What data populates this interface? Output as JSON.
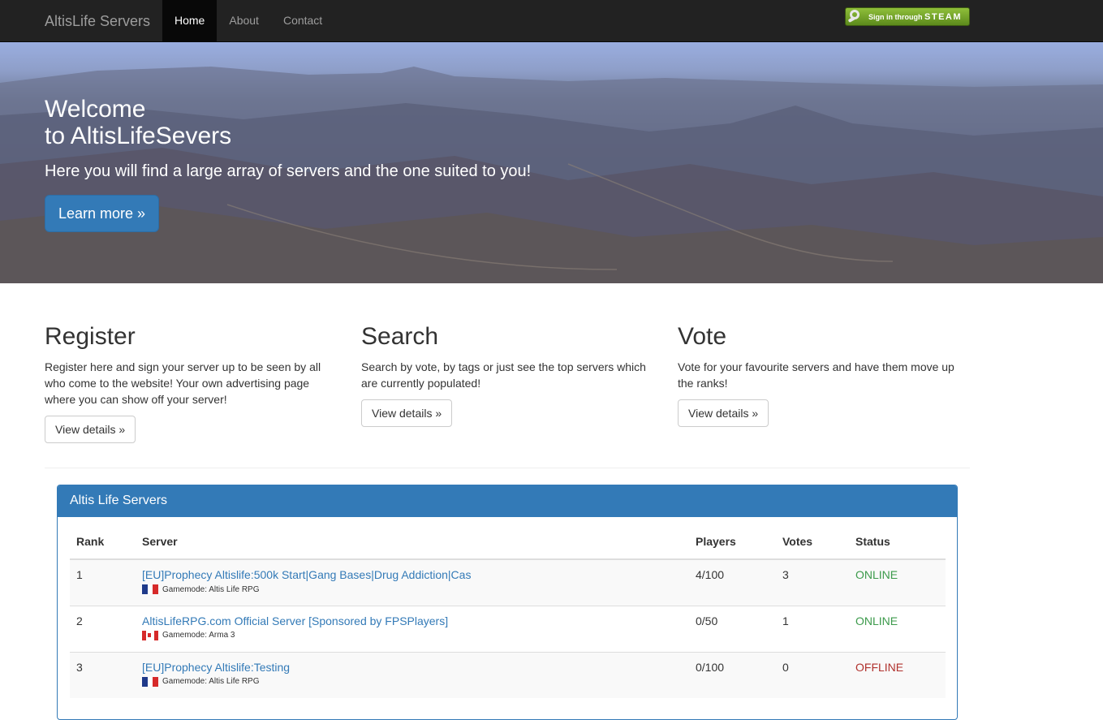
{
  "navbar": {
    "brand": "AltisLife Servers",
    "links": [
      {
        "label": "Home",
        "active": true
      },
      {
        "label": "About",
        "active": false
      },
      {
        "label": "Contact",
        "active": false
      }
    ],
    "steam_button": {
      "prefix": "Sign in through",
      "brand": "STEAM",
      "icon": "steam-logo-icon"
    }
  },
  "hero": {
    "title_line1": "Welcome",
    "title_line2": "to AltisLifeSevers",
    "subtitle": "Here you will find a large array of servers and the one suited to you!",
    "button_label": "Learn more »"
  },
  "features": [
    {
      "title": "Register",
      "text": "Register here and sign your server up to be seen by all who come to the website! Your own advertising page where you can show off your server!",
      "button": "View details »"
    },
    {
      "title": "Search",
      "text": "Search by vote, by tags or just see the top servers which are currently populated!",
      "button": "View details »"
    },
    {
      "title": "Vote",
      "text": "Vote for your favourite servers and have them move up the ranks!",
      "button": "View details »"
    }
  ],
  "servers_panel": {
    "title": "Altis Life Servers",
    "columns": [
      "Rank",
      "Server",
      "Players",
      "Votes",
      "Status"
    ],
    "rows": [
      {
        "rank": "1",
        "name": "[EU]Prophecy Altislife:500k Start|Gang Bases|Drug Addiction|Cas",
        "gamemode": "Gamemode: Altis Life RPG",
        "flag": "france",
        "players": "4/100",
        "votes": "3",
        "status": "ONLINE"
      },
      {
        "rank": "2",
        "name": "AltisLifeRPG.com Official Server [Sponsored by FPSPlayers]",
        "gamemode": "Gamemode: Arma 3",
        "flag": "canada",
        "players": "0/50",
        "votes": "1",
        "status": "ONLINE"
      },
      {
        "rank": "3",
        "name": "[EU]Prophecy Altislife:Testing",
        "gamemode": "Gamemode: Altis Life RPG",
        "flag": "france",
        "players": "0/100",
        "votes": "0",
        "status": "OFFLINE"
      }
    ]
  },
  "colors": {
    "primary": "#337ab7",
    "navbar": "#222222",
    "online": "#3c9a4b",
    "offline": "#b0312d"
  }
}
